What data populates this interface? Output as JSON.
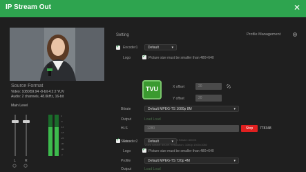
{
  "window": {
    "title": "IP Stream Out",
    "close_glyph": "✕"
  },
  "source": {
    "title": "Source Format",
    "video": "Video: 1080i59.94 -8-bit 4:2:2 YUV",
    "audio": "Audio: 2 channels, 48.0kHz, 16-bit",
    "main_level": "Main Level"
  },
  "meter": {
    "l_label": "L",
    "r_label": "R",
    "scale": [
      "0",
      "-6",
      "-12",
      "-18",
      "-24",
      "-30",
      "-40",
      "-∞"
    ]
  },
  "right": {
    "setting": "Setting",
    "profile_management": "Profile Management",
    "encoder1": {
      "label": "Encoder1",
      "preset": "Default",
      "logo_label": "Logo",
      "picture_note": "Picture size must be smaller than 480×640",
      "logo_text": "TVU",
      "x_offset_label": "X offset",
      "x_offset_value": "20",
      "y_offset_label": "Y offset",
      "y_offset_value": "20",
      "bitrate_label": "Bitrate",
      "bitrate_value": "Default MPEG-TS 1080p 8M",
      "output_label": "Output",
      "output_value": "Load Load",
      "hls_label": "HLS",
      "hls_url": "1280",
      "hls_button": "Stop",
      "hls_code": "778348",
      "status_label": "Status",
      "status_lines": [
        "Audio Bitrate: 128K   Current Bitrate: 8000K",
        "Video Bitrate: 8000K   Resolution: 1080p 1920x1080"
      ]
    },
    "encoder2": {
      "label": "Encoder2",
      "preset": "Default",
      "logo_label": "Logo",
      "picture_note": "Picture size must be smaller than 480×640",
      "profile_label": "Profile",
      "profile_value": "Default MPEG-TS 720p 4M",
      "output_label": "Output",
      "output_value": "Load Load"
    }
  },
  "colors": {
    "accent": "#2ea44f",
    "stop": "#e02020"
  }
}
